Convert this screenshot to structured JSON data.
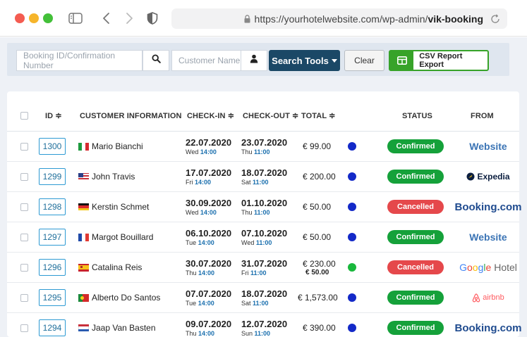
{
  "browser": {
    "url_prefix": "https://yourhotelwebsite.com/wp-admin/",
    "url_bold": "vik-booking"
  },
  "toolbar": {
    "booking_placeholder": "Booking ID/Confirmation Number",
    "customer_placeholder": "Customer Name",
    "search_tools_label": "Search Tools",
    "clear_label": "Clear",
    "csv_label": "CSV Report Export"
  },
  "table": {
    "headers": {
      "id": "ID ≑",
      "customer": "CUSTOMER INFORMATION",
      "checkin": "CHECK-IN ≑",
      "checkout": "CHECK-OUT ≑",
      "total": "TOTAL ≑",
      "status": "STATUS",
      "from": "FROM"
    },
    "rows": [
      {
        "id": "1300",
        "flag": "it",
        "name": "Mario Bianchi",
        "checkin_date": "22.07.2020",
        "checkin_day": "Wed",
        "checkin_time": "14:00",
        "checkout_date": "23.07.2020",
        "checkout_day": "Thu",
        "checkout_time": "11:00",
        "total": "€ 99.00",
        "total_sub": "",
        "dot_color": "#1329c8",
        "status": "Confirmed",
        "status_color": "#15a13a",
        "from": "Website",
        "from_style": "website"
      },
      {
        "id": "1299",
        "flag": "us",
        "name": "John Travis",
        "checkin_date": "17.07.2020",
        "checkin_day": "Fri",
        "checkin_time": "14:00",
        "checkout_date": "18.07.2020",
        "checkout_day": "Sat",
        "checkout_time": "11:00",
        "total": "€ 200.00",
        "total_sub": "",
        "dot_color": "#1329c8",
        "status": "Confirmed",
        "status_color": "#15a13a",
        "from": "Expedia",
        "from_style": "expedia"
      },
      {
        "id": "1298",
        "flag": "de",
        "name": "Kerstin Schmet",
        "checkin_date": "30.09.2020",
        "checkin_day": "Wed",
        "checkin_time": "14:00",
        "checkout_date": "01.10.2020",
        "checkout_day": "Thu",
        "checkout_time": "11:00",
        "total": "€ 50.00",
        "total_sub": "",
        "dot_color": "#1329c8",
        "status": "Cancelled",
        "status_color": "#e5484b",
        "from": "Booking.com",
        "from_style": "booking"
      },
      {
        "id": "1297",
        "flag": "fr",
        "name": "Margot Bouillard",
        "checkin_date": "06.10.2020",
        "checkin_day": "Tue",
        "checkin_time": "14:00",
        "checkout_date": "07.10.2020",
        "checkout_day": "Wed",
        "checkout_time": "11:00",
        "total": "€ 50.00",
        "total_sub": "",
        "dot_color": "#1329c8",
        "status": "Confirmed",
        "status_color": "#15a13a",
        "from": "Website",
        "from_style": "website"
      },
      {
        "id": "1296",
        "flag": "es",
        "name": "Catalina Reis",
        "checkin_date": "30.07.2020",
        "checkin_day": "Thu",
        "checkin_time": "14:00",
        "checkout_date": "31.07.2020",
        "checkout_day": "Fri",
        "checkout_time": "11:00",
        "total": "€ 230.00",
        "total_sub": "€ 50.00",
        "dot_color": "#19b83c",
        "status": "Cancelled",
        "status_color": "#e5484b",
        "from": "Google Hotel",
        "from_style": "google"
      },
      {
        "id": "1295",
        "flag": "pt",
        "name": "Alberto Do Santos",
        "checkin_date": "07.07.2020",
        "checkin_day": "Tue",
        "checkin_time": "14:00",
        "checkout_date": "18.07.2020",
        "checkout_day": "Sat",
        "checkout_time": "11:00",
        "total": "€ 1,573.00",
        "total_sub": "",
        "dot_color": "#1329c8",
        "status": "Confirmed",
        "status_color": "#15a13a",
        "from": "airbnb",
        "from_style": "airbnb"
      },
      {
        "id": "1294",
        "flag": "nl",
        "name": "Jaap Van Basten",
        "checkin_date": "09.07.2020",
        "checkin_day": "Thu",
        "checkin_time": "14:00",
        "checkout_date": "12.07.2020",
        "checkout_day": "Sun",
        "checkout_time": "11:00",
        "total": "€ 390.00",
        "total_sub": "",
        "dot_color": "#1329c8",
        "status": "Confirmed",
        "status_color": "#15a13a",
        "from": "Booking.com",
        "from_style": "booking"
      }
    ]
  }
}
